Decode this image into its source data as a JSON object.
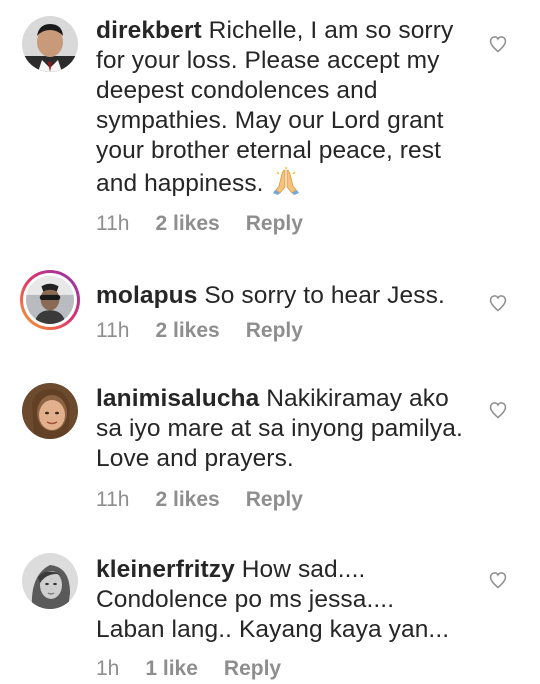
{
  "comments": [
    {
      "username": "direkbert",
      "text": " Richelle, I am so sorry for your loss. Please accept my deepest condolences and sympathies. May our Lord grant your brother eternal peace, rest and happiness. ",
      "emoji": "folded-hands",
      "time": "11h",
      "likes": "2 likes",
      "reply": "Reply"
    },
    {
      "username": "molapus",
      "text": " So sorry to hear Jess.",
      "time": "11h",
      "likes": "2 likes",
      "reply": "Reply"
    },
    {
      "username": "lanimisalucha",
      "text": " Nakikiramay ako sa iyo mare at sa inyong pamilya. Love and prayers.",
      "time": "11h",
      "likes": "2 likes",
      "reply": "Reply"
    },
    {
      "username": "kleinerfritzy",
      "text": " How sad.... Condolence po ms jessa.... Laban lang.. Kayang kaya yan...",
      "time": "1h",
      "likes": "1 like",
      "reply": "Reply"
    }
  ],
  "icons": {
    "like": "heart-outline-icon"
  },
  "colors": {
    "text": "#262626",
    "meta": "#8e8e8e",
    "heart": "#8e8e8e"
  }
}
